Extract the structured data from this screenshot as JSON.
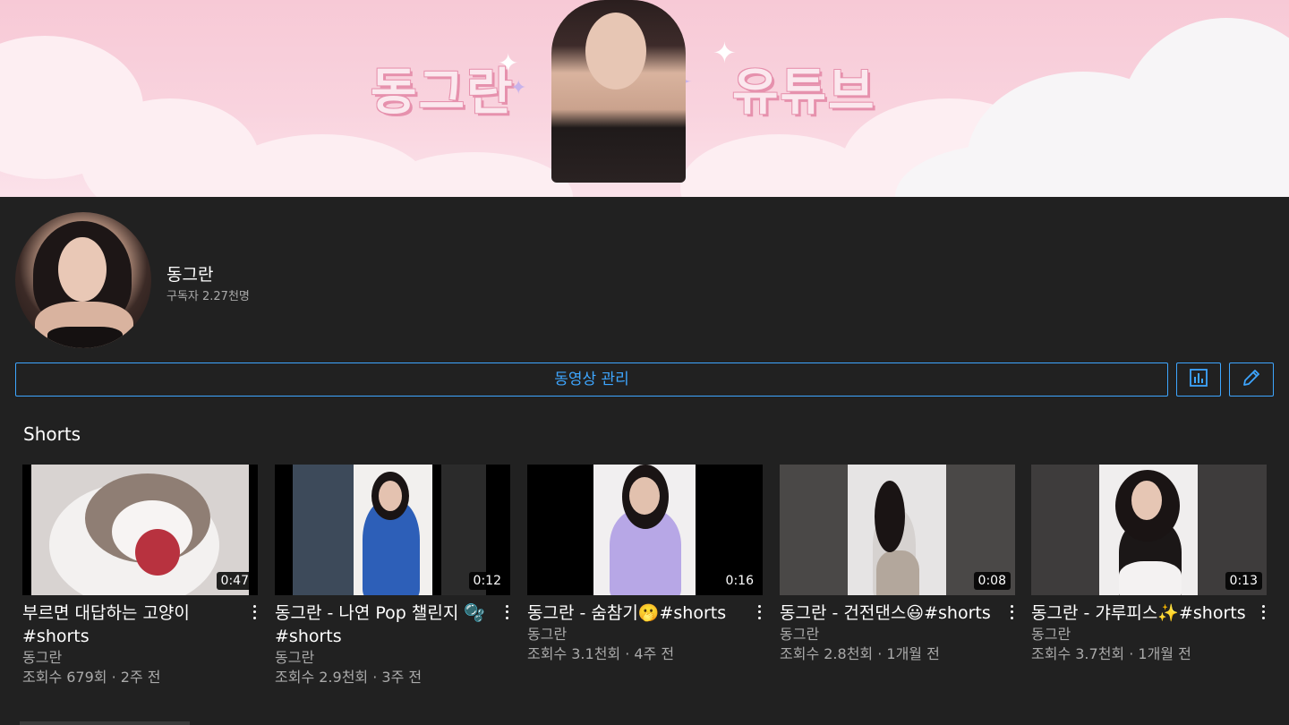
{
  "banner": {
    "left_text": "동그란",
    "right_text": "유튜브"
  },
  "channel": {
    "name": "동그란",
    "subscribers": "구독자 2.27천명"
  },
  "actions": {
    "manage_label": "동영상 관리",
    "analytics_icon": "bar-chart-icon",
    "edit_icon": "pencil-icon"
  },
  "section": {
    "title": "Shorts"
  },
  "colors": {
    "accent": "#3ea6ff",
    "background": "#212121",
    "secondary_text": "#aaaaaa"
  },
  "shorts": [
    {
      "title_line1": "부르면 대답하는 고양이",
      "title_line2": "#shorts",
      "channel": "동그란",
      "stats": "조회수 679회 · 2주 전",
      "duration": "0:47"
    },
    {
      "title_line1": "동그란 - 나연 Pop 챌린지 🫧",
      "title_line2": "#shorts",
      "channel": "동그란",
      "stats": "조회수 2.9천회 · 3주 전",
      "duration": "0:12"
    },
    {
      "title_line1": "동그란 - 숨참기🫢#shorts",
      "title_line2": "",
      "channel": "동그란",
      "stats": "조회수 3.1천회 · 4주 전",
      "duration": "0:16"
    },
    {
      "title_line1": "동그란 - 건전댄스😃#shorts",
      "title_line2": "",
      "channel": "동그란",
      "stats": "조회수 2.8천회 · 1개월 전",
      "duration": "0:08"
    },
    {
      "title_line1": "동그란 - 갸루피스✨#shorts",
      "title_line2": "",
      "channel": "동그란",
      "stats": "조회수 3.7천회 · 1개월 전",
      "duration": "0:13"
    }
  ]
}
